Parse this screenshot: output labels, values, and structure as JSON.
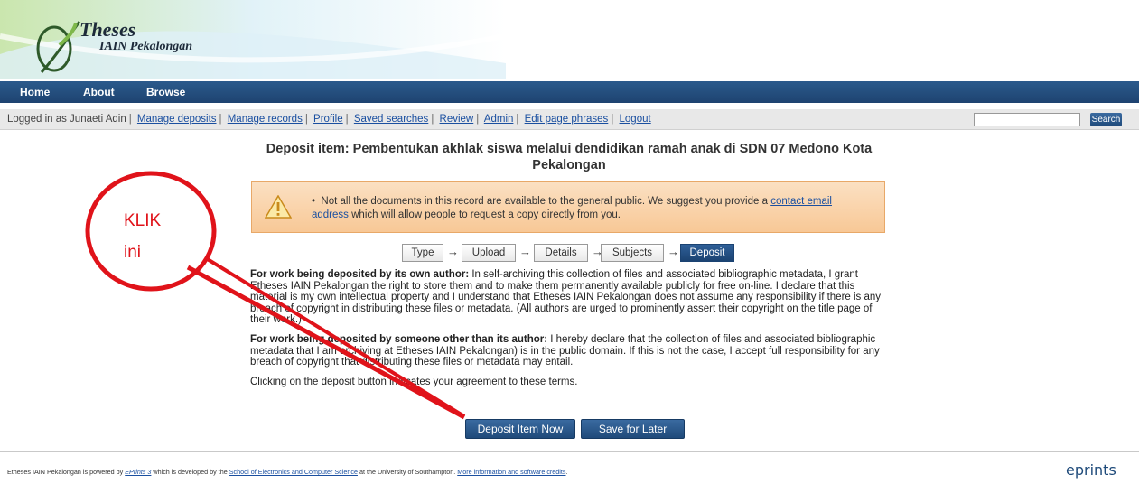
{
  "header": {
    "logo_title": "Theses",
    "logo_subtitle": "IAIN Pekalongan"
  },
  "nav": {
    "items": [
      "Home",
      "About",
      "Browse"
    ]
  },
  "userbar": {
    "logged_in": "Logged in as Junaeti Aqin",
    "links": [
      "Manage deposits",
      "Manage records",
      "Profile",
      "Saved searches",
      "Review",
      "Admin",
      "Edit page phrases",
      "Logout"
    ]
  },
  "search": {
    "value": "",
    "button": "Search"
  },
  "page": {
    "title": "Deposit item: Pembentukan akhlak siswa melalui dendidikan ramah anak di SDN 07 Medono Kota Pekalongan"
  },
  "warning": {
    "text_before": "Not all the documents in this record are available to the general public. We suggest you provide a ",
    "link": "contact email address",
    "text_after": " which will allow people to request a copy directly from you."
  },
  "wizard": {
    "steps": [
      "Type",
      "Upload",
      "Details",
      "Subjects",
      "Deposit"
    ],
    "active": "Deposit"
  },
  "terms": {
    "p1_bold": "For work being deposited by its own author:",
    "p1": " In self-archiving this collection of files and associated bibliographic metadata, I grant Etheses IAIN Pekalongan the right to store them and to make them permanently available publicly for free on-line. I declare that this material is my own intellectual property and I understand that Etheses IAIN Pekalongan does not assume any responsibility if there is any breach of copyright in distributing these files or metadata. (All authors are urged to prominently assert their copyright on the title page of their work.)",
    "p2_bold": "For work being deposited by someone other than its author:",
    "p2": " I hereby declare that the collection of files and associated bibliographic metadata that I am archiving at Etheses IAIN Pekalongan) is in the public domain. If this is not the case, I accept full responsibility for any breach of copyright that distributing these files or metadata may entail.",
    "p3": "Clicking on the deposit button indicates your agreement to these terms."
  },
  "buttons": {
    "deposit": "Deposit Item Now",
    "save": "Save for Later"
  },
  "footer": {
    "t1": "Etheses IAIN Pekalongan is powered by ",
    "l1": "EPrints 3",
    "t2": " which is developed by the ",
    "l2": "School of Electronics and Computer Science",
    "t3": " at the University of Southampton. ",
    "l3": "More information and software credits",
    "t4": "."
  },
  "eprints_logo": "eprints",
  "annotation": {
    "line1": "KLIK",
    "line2": "ini",
    "color": "#e0131a"
  }
}
